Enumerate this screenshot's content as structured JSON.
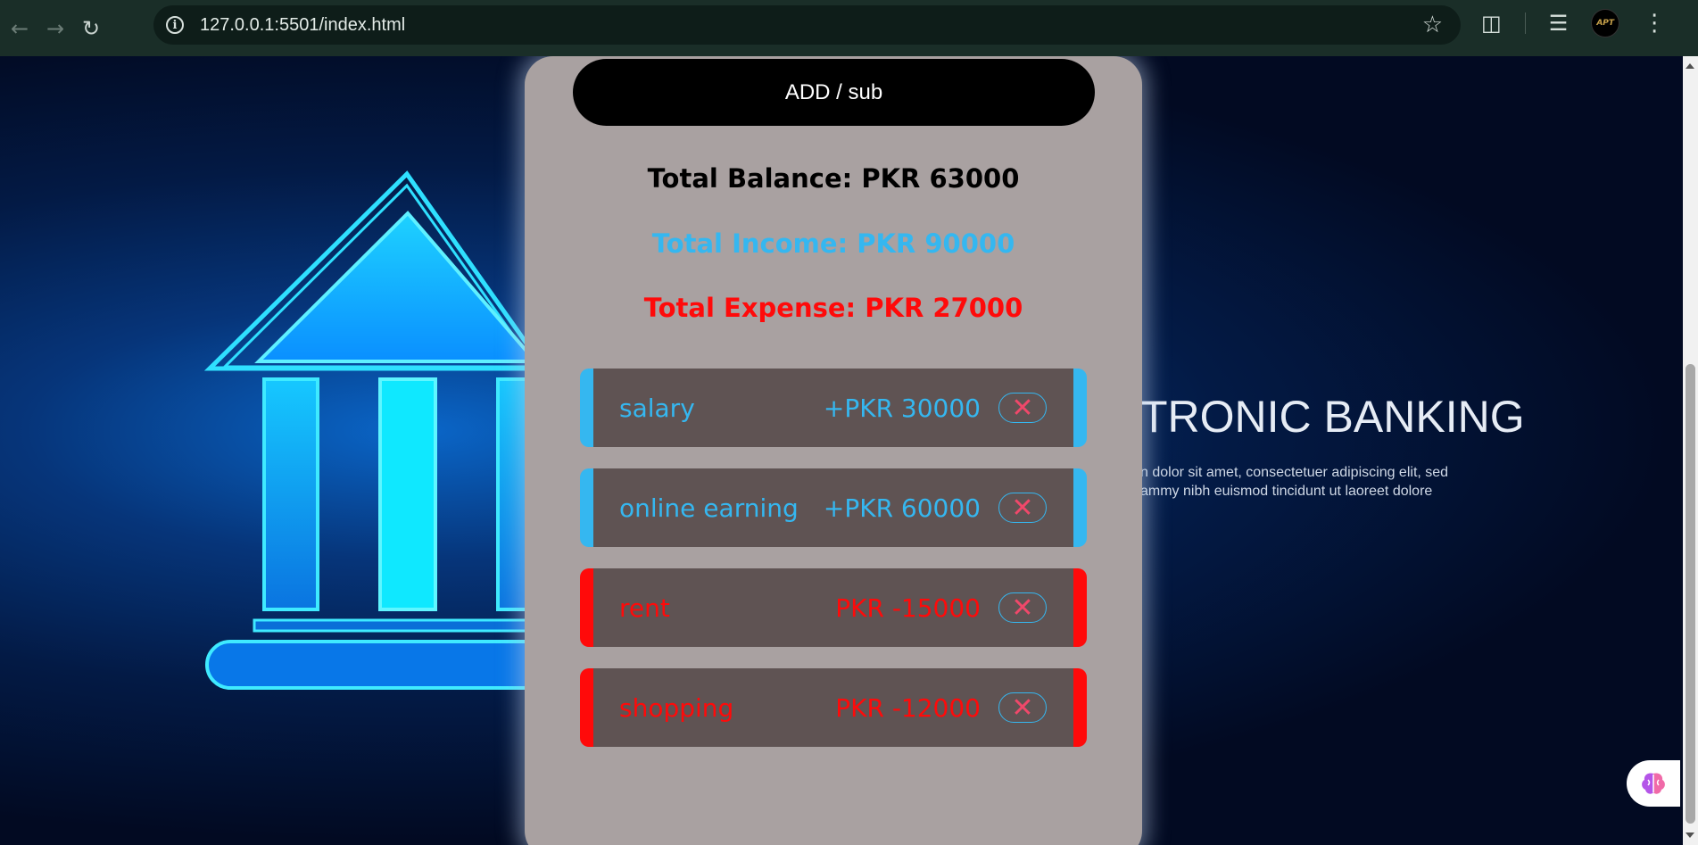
{
  "browser": {
    "url": "127.0.0.1:5501/index.html",
    "profile_label": "APT"
  },
  "background": {
    "banner_title": "TRONIC BANKING",
    "banner_text_line1": "n dolor sit amet, consectetuer adipiscing elit, sed",
    "banner_text_line2": "ammy nibh euismod tincidunt ut laoreet dolore"
  },
  "tracker": {
    "add_button_label": "ADD / sub",
    "total_balance": "Total Balance: PKR 63000",
    "total_income": "Total Income: PKR 90000",
    "total_expense": "Total Expense: PKR 27000",
    "transactions": [
      {
        "name": "salary",
        "amount": "+PKR 30000",
        "type": "income"
      },
      {
        "name": "online earning",
        "amount": "+PKR 60000",
        "type": "income"
      },
      {
        "name": "rent",
        "amount": "PKR -15000",
        "type": "expense"
      },
      {
        "name": "shopping",
        "amount": "PKR -12000",
        "type": "expense"
      }
    ],
    "delete_glyph": "✕"
  },
  "colors": {
    "income": "#35b7f0",
    "expense": "#ff0a0a",
    "card_bg": "#a9a1a1",
    "row_bg": "#5f5353"
  }
}
